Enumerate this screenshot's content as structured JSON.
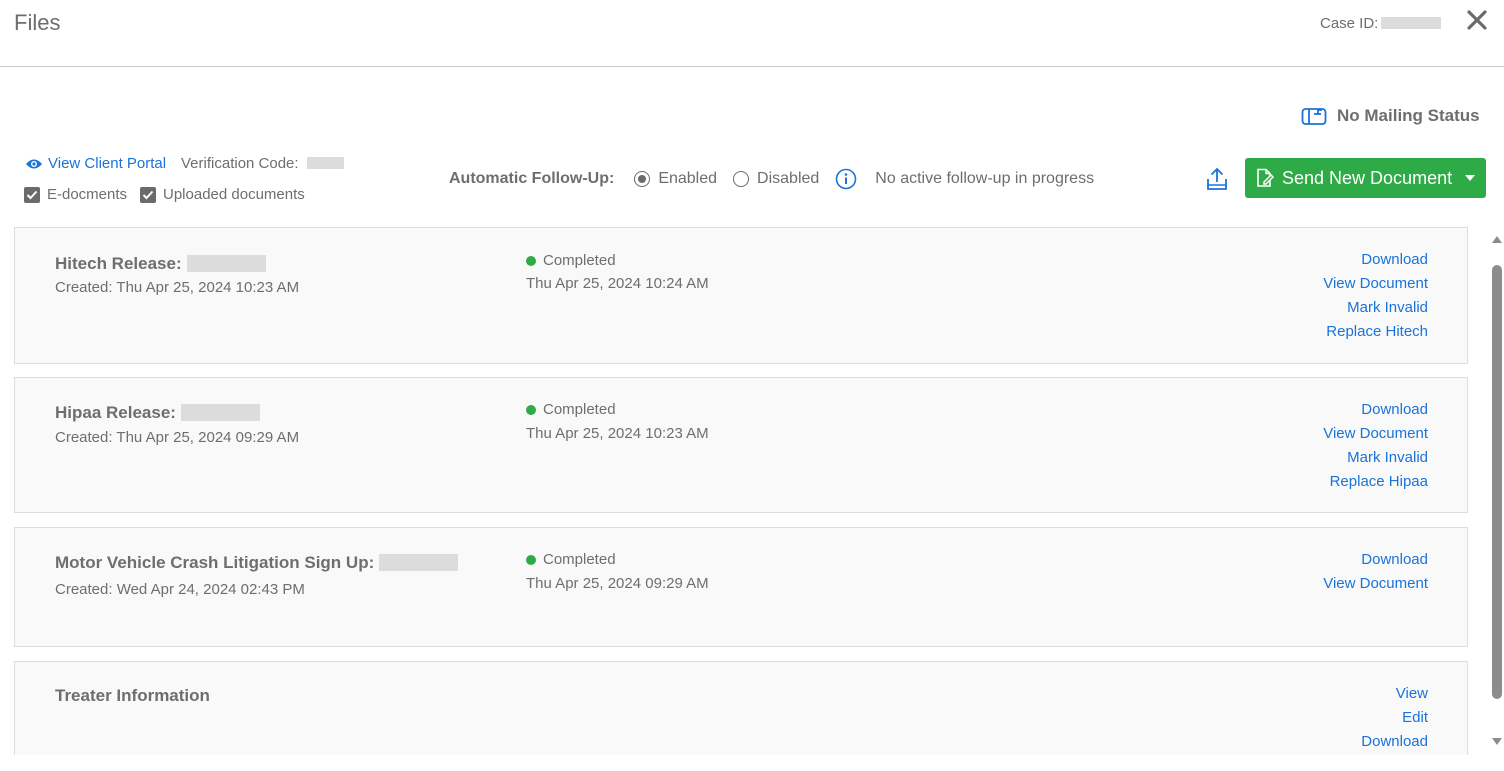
{
  "header": {
    "title": "Files",
    "case_id_label": "Case ID:"
  },
  "mailing": {
    "status": "No Mailing Status",
    "icon": "mailbox-icon"
  },
  "portal": {
    "link_label": "View Client Portal",
    "verification_label": "Verification Code:"
  },
  "filters": {
    "edocs_label": "E-docments",
    "edocs_checked": true,
    "uploaded_label": "Uploaded documents",
    "uploaded_checked": true
  },
  "followup": {
    "label": "Automatic Follow-Up:",
    "enabled_label": "Enabled",
    "disabled_label": "Disabled",
    "selected": "Enabled",
    "status_text": "No active follow-up in progress"
  },
  "toolbar": {
    "send_label": "Send New Document",
    "send_color": "#2eaa47"
  },
  "documents": [
    {
      "title": "Hitech Release:",
      "created": "Created: Thu Apr 25, 2024 10:23 AM",
      "status": "Completed",
      "status_date": "Thu Apr 25, 2024 10:24 AM",
      "actions": [
        "Download",
        "View Document",
        "Mark Invalid",
        "Replace Hitech"
      ]
    },
    {
      "title": "Hipaa Release:",
      "created": "Created: Thu Apr 25, 2024 09:29 AM",
      "status": "Completed",
      "status_date": "Thu Apr 25, 2024 10:23 AM",
      "actions": [
        "Download",
        "View Document",
        "Mark Invalid",
        "Replace Hipaa"
      ]
    },
    {
      "title": "Motor Vehicle Crash Litigation Sign Up:",
      "created": "Created: Wed Apr 24, 2024 02:43 PM",
      "status": "Completed",
      "status_date": "Thu Apr 25, 2024 09:29 AM",
      "actions": [
        "Download",
        "View Document"
      ]
    },
    {
      "title": "Treater Information",
      "actions": [
        "View",
        "Edit",
        "Download"
      ]
    }
  ]
}
